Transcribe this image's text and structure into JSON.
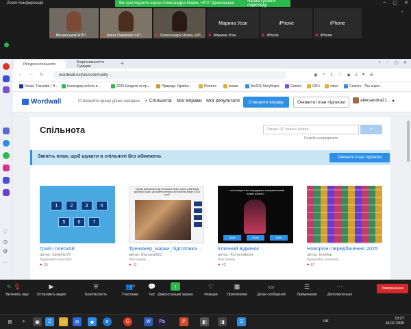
{
  "zoom": {
    "window_title": "Zoom Конференція",
    "banner": "Ви проглядаєте екран Олександра Новик, НПП \"Деснянсько",
    "view_settings": "Налаштування перегляду",
    "participants": [
      {
        "label": "Мезинський НПП",
        "kind": "video"
      },
      {
        "label": "Ірина Павленко НП...",
        "kind": "video"
      },
      {
        "label": "Олександра Новик, НП...",
        "kind": "video"
      },
      {
        "label": "Марина Усок",
        "sublabel": "Марина Усок",
        "kind": "name"
      },
      {
        "label": "iPhone",
        "sublabel": "iPhone",
        "kind": "name"
      },
      {
        "label": "iPhone",
        "sublabel": "iPhone",
        "kind": "name"
      }
    ],
    "toolbar": [
      {
        "label": "Включить звук",
        "icon": "microphone-muted-icon"
      },
      {
        "label": "Остановить видео",
        "icon": "video-camera-icon"
      },
      {
        "label": "Безопасность",
        "icon": "shield-icon"
      },
      {
        "label": "Участники",
        "icon": "participants-icon",
        "count": "6"
      },
      {
        "label": "Чат",
        "icon": "chat-icon"
      },
      {
        "label": "Демонстрация экрана",
        "icon": "share-screen-icon"
      },
      {
        "label": "Реакции",
        "icon": "reaction-heart-icon"
      },
      {
        "label": "Приложения",
        "icon": "apps-icon"
      },
      {
        "label": "Доски сообщений",
        "icon": "whiteboard-icon"
      },
      {
        "label": "Примечания",
        "icon": "notes-icon"
      },
      {
        "label": "Дополнительно",
        "icon": "more-icon"
      }
    ],
    "end_label": "Завершение"
  },
  "browser": {
    "tabs": [
      {
        "label": "Ресурси спільноти",
        "active": true
      },
      {
        "label": "Біорізноманіття Сумщин",
        "active": false
      }
    ],
    "url": "wordwall.net/uk/community",
    "bookmarks": [
      "DeepL Translate | Н...",
      "Календар роботи в...",
      "2025 Екодати та пр...",
      "Природа України...",
      "Pictures",
      "іконки",
      "ArcGIS StoryMaps",
      "Gemini",
      "GIFs",
      "video",
      "Coolors - The super..."
    ]
  },
  "wordwall": {
    "logo": "Wordwall",
    "tagline": "Створюйте кращі уроки швидше",
    "nav": [
      "Спільнота",
      "Мої вправи",
      "Мої результати"
    ],
    "create_btn": "Створити вправу",
    "upgrade_btn": "Оновити план підписки",
    "user": "aleksandra21...",
    "page_title": "Спільнота",
    "search_placeholder": "Пошук НП ліниса Новиа",
    "search_btn": "⌕",
    "search_note": "Потрібна передплата",
    "promo_text": "Змініть план, щоб шукати в спільноті без обмежень",
    "promo_btn": "Оновити план підписки",
    "activities": [
      {
        "name": "Грай і плескАй",
        "author": "автор: Julia0hlo76",
        "type": "Відкрийте коробку",
        "likes": "33",
        "numbers": [
          "1",
          "2",
          "3",
          "4",
          "5",
          "6",
          "7"
        ]
      },
      {
        "name": "Тренажер_марки_підготовка ...",
        "author": "автор: Gavsarai623",
        "type": "Вікторина",
        "likes": "12",
        "caption": "Скільки років минуло від Хотинської битви, участь у якій взяли українські козаки, до моменту випуску цієї поштової марки в 2021 році?"
      },
      {
        "name": "Кличний відмінок",
        "author": "автор: Tochumakova",
        "type": "Вікторина",
        "likes": "43",
        "caption": "... чи плануєте ви порадувати шанувальників нових пісень?",
        "options": [
          "Юлія",
          "Юлію",
          "Юліє"
        ]
      },
      {
        "name": "Новорічні передбачення 2025",
        "author": "автор: Irushlop",
        "type": "Відкрийте коробку",
        "likes": "57"
      }
    ]
  },
  "system": {
    "lang": "UK",
    "time": "13:27",
    "date": "16.07.2025"
  }
}
